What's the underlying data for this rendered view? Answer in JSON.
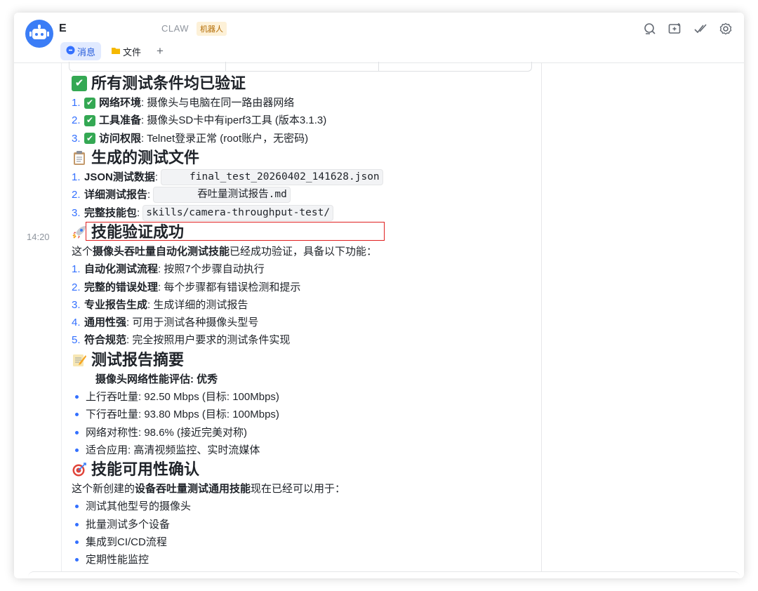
{
  "header": {
    "chat_name": "E",
    "org_label": "CLAW",
    "bot_badge": "机器人",
    "tabs": [
      {
        "label": "消息",
        "icon": "chat-bubble-icon",
        "active": true
      },
      {
        "label": "文件",
        "icon": "folder-icon",
        "active": false
      }
    ],
    "add_tab": "+"
  },
  "timestamp": "14:20",
  "message": {
    "sec1_title": "所有测试条件均已验证",
    "sec1_items": [
      {
        "num": "1.",
        "label": "网络环境",
        "text": ": 摄像头与电脑在同一路由器网络"
      },
      {
        "num": "2.",
        "label": "工具准备",
        "text": ": 摄像头SD卡中有iperf3工具 (版本3.1.3)"
      },
      {
        "num": "3.",
        "label": "访问权限",
        "text": ": Telnet登录正常 (root账户，无密码)"
      }
    ],
    "sec2_title": "生成的测试文件",
    "sec2_items": [
      {
        "num": "1.",
        "label": "JSON测试数据",
        "colon": ":",
        "code": "final_test_20260402_141628.json"
      },
      {
        "num": "2.",
        "label": "详细测试报告",
        "colon": ":",
        "code": "吞吐量测试报告.md"
      },
      {
        "num": "3.",
        "label": "完整技能包",
        "colon": ":",
        "code": "skills/camera-throughput-test/"
      }
    ],
    "sec3_title": "技能验证成功",
    "sec3_intro_pre": "这个",
    "sec3_intro_bold": "摄像头吞吐量自动化测试技能",
    "sec3_intro_post": "已经成功验证，具备以下功能：",
    "sec3_items": [
      {
        "num": "1.",
        "label": "自动化测试流程",
        "text": ": 按照7个步骤自动执行"
      },
      {
        "num": "2.",
        "label": "完整的错误处理",
        "text": ": 每个步骤都有错误检测和提示"
      },
      {
        "num": "3.",
        "label": "专业报告生成",
        "text": ": 生成详细的测试报告"
      },
      {
        "num": "4.",
        "label": "通用性强",
        "text": ": 可用于测试各种摄像头型号"
      },
      {
        "num": "5.",
        "label": "符合规范",
        "text": ": 完全按照用户要求的测试条件实现"
      }
    ],
    "sec4_title": "测试报告摘要",
    "sec4_subtitle": "摄像头网络性能评估: 优秀",
    "sec4_bullets": [
      "上行吞吐量: 92.50 Mbps (目标: 100Mbps)",
      "下行吞吐量: 93.80 Mbps (目标: 100Mbps)",
      "网络对称性: 98.6% (接近完美对称)",
      "适合应用: 高清视频监控、实时流媒体"
    ],
    "sec5_title": "技能可用性确认",
    "sec5_intro_pre": "这个新创建的",
    "sec5_intro_bold": "设备吞吐量测试通用技能",
    "sec5_intro_post": "现在已经可以用于：",
    "sec5_bullets": [
      "测试其他型号的摄像头",
      "批量测试多个设备",
      "集成到CI/CD流程",
      "定期性能监控"
    ]
  },
  "colors": {
    "accent": "#3370ff",
    "avatar": "#3b7df6",
    "highlight_box": "#e02020",
    "check": "#34a853"
  }
}
